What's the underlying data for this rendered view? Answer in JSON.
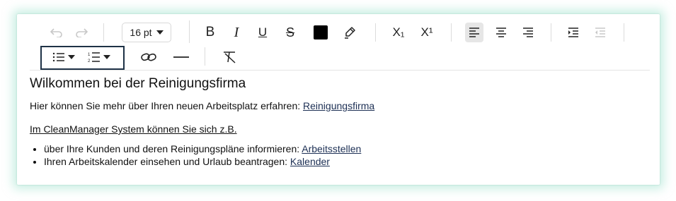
{
  "toolbar": {
    "undo_icon": "undo-icon",
    "redo_icon": "redo-icon",
    "font_size": "16 pt",
    "bold": "B",
    "italic": "I",
    "underline": "U",
    "strikethrough": "S",
    "text_color": "#000000",
    "subscript": "X₁",
    "superscript": "X¹"
  },
  "content": {
    "heading": "Wilkommen bei der Reinigungsfirma",
    "intro_text": "Hier können Sie mehr über Ihren neuen Arbeitsplatz erfahren: ",
    "intro_link": "Reinigungsfirma",
    "subheading": "Im CleanManager System können Sie sich z.B.",
    "list": [
      {
        "text": "über Ihre Kunden und deren Reinigungspläne informieren: ",
        "link": "Arbeitsstellen"
      },
      {
        "text": "Ihren Arbeitskalender einsehen und Urlaub beantragen: ",
        "link": "Kalender"
      }
    ]
  }
}
